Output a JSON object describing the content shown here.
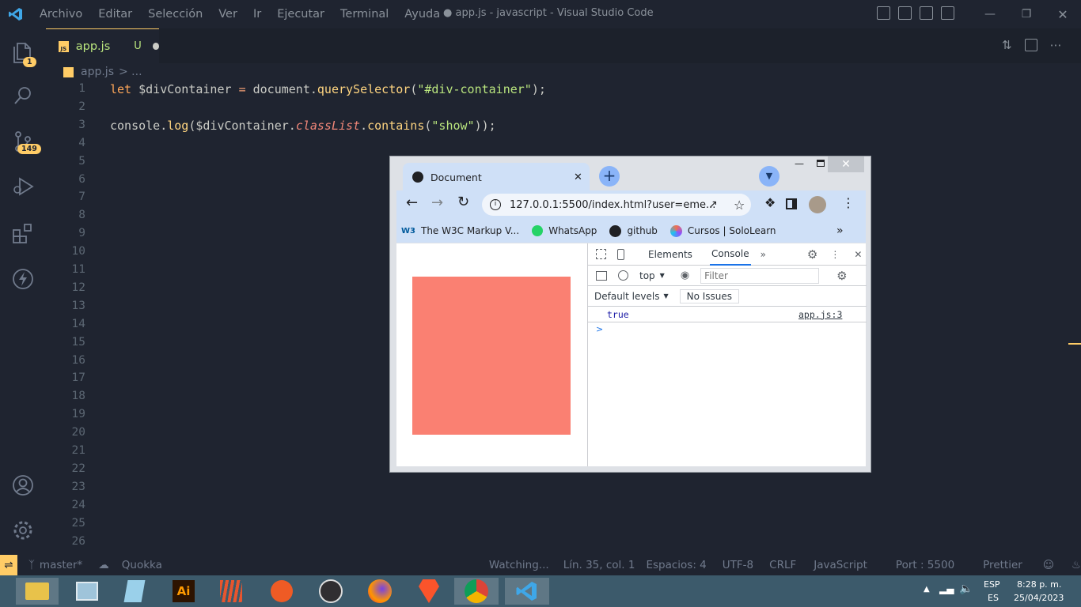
{
  "titlebar": {
    "menu": [
      "Archivo",
      "Editar",
      "Selección",
      "Ver",
      "Ir",
      "Ejecutar",
      "Terminal",
      "Ayuda"
    ],
    "title": "● app.js - javascript - Visual Studio Code"
  },
  "activity": {
    "explorer_badge": "1",
    "scm_badge": "149"
  },
  "tab": {
    "icon": "JS",
    "name": "app.js",
    "status": "U"
  },
  "breadcrumb": {
    "file": "app.js",
    "rest": "> ..."
  },
  "editor": {
    "line_numbers": [
      "1",
      "2",
      "3",
      "4",
      "5",
      "6",
      "7",
      "8",
      "9",
      "10",
      "11",
      "12",
      "13",
      "14",
      "15",
      "16",
      "17",
      "18",
      "19",
      "20",
      "21",
      "22",
      "23",
      "24",
      "25",
      "26"
    ],
    "line1": {
      "kw": "let",
      "var": " $divContainer ",
      "op": "=",
      "obj": " document.",
      "fn": "querySelector",
      "p1": "(",
      "str": "\"#div-container\"",
      "p2": ");"
    },
    "line3": {
      "obj": "console.",
      "fn": "log",
      "p1": "($divContainer.",
      "prop": "classList",
      "dot": ".",
      "fn2": "contains",
      "p2": "(",
      "str": "\"show\"",
      "p3": "));"
    }
  },
  "statusbar": {
    "branch": "master*",
    "quokka": "Quokka",
    "watching": "Watching...",
    "position": "Lín. 35, col. 1",
    "spaces": "Espacios: 4",
    "encoding": "UTF-8",
    "eol": "CRLF",
    "language": "JavaScript",
    "port": "Port : 5500",
    "prettier": "Prettier"
  },
  "taskbar": {
    "lang1": "ESP",
    "lang2": "ES",
    "time": "8:28 p. m.",
    "date": "25/04/2023"
  },
  "chrome": {
    "tab_title": "Document",
    "url": "127.0.0.1:5500/index.html?user=eme...",
    "bookmarks": [
      {
        "icon": "W3",
        "label": "The W3C Markup V..."
      },
      {
        "icon": "whatsapp-icon",
        "label": "WhatsApp"
      },
      {
        "icon": "github-icon",
        "label": "github"
      },
      {
        "icon": "sololearn-icon",
        "label": "Cursos | SoloLearn"
      }
    ],
    "square_color": "#fa8072"
  },
  "devtools": {
    "tabs": [
      "Elements",
      "Console"
    ],
    "context": "top",
    "filter_placeholder": "Filter",
    "levels": "Default levels",
    "issues": "No Issues",
    "log_value": "true",
    "log_source": "app.js:3",
    "prompt": ">"
  },
  "colors": {
    "accent": "#ffcc66",
    "bg": "#1f2430",
    "salmon": "#fa8072"
  }
}
